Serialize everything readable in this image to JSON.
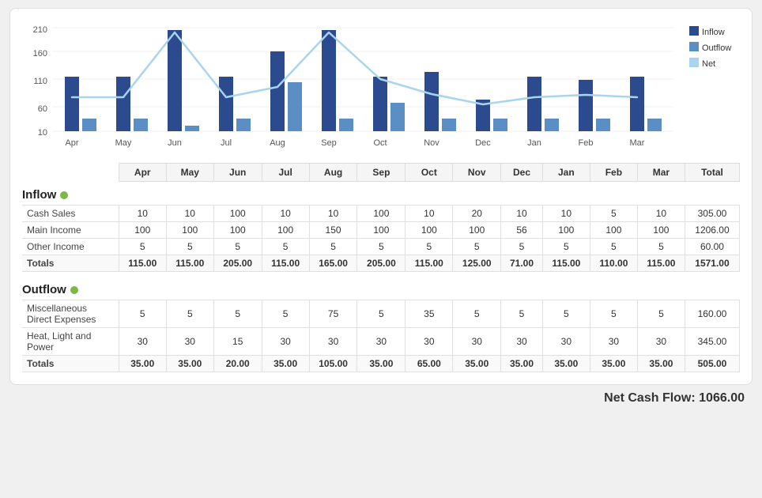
{
  "chart": {
    "months": [
      "Apr",
      "May",
      "Jun",
      "Jul",
      "Aug",
      "Sep",
      "Oct",
      "Nov",
      "Dec",
      "Jan",
      "Feb",
      "Mar"
    ],
    "inflow": [
      115,
      115,
      205,
      115,
      165,
      205,
      115,
      125,
      71,
      115,
      110,
      115
    ],
    "outflow": [
      35,
      35,
      20,
      35,
      105,
      35,
      65,
      35,
      35,
      35,
      35,
      35
    ],
    "yAxis": [
      210,
      160,
      110,
      60,
      10
    ],
    "colors": {
      "inflow": "#2c4b8e",
      "outflow": "#5b8ec4",
      "net": "#a8d4f0"
    }
  },
  "legend": {
    "items": [
      {
        "label": "Inflow",
        "color": "#2c4b8e"
      },
      {
        "label": "Outflow",
        "color": "#5b8ec4"
      },
      {
        "label": "Net",
        "color": "#a8d4f0"
      }
    ]
  },
  "table": {
    "columns": [
      "",
      "Apr",
      "May",
      "Jun",
      "Jul",
      "Aug",
      "Sep",
      "Oct",
      "Nov",
      "Dec",
      "Jan",
      "Feb",
      "Mar",
      "Total"
    ],
    "inflow_section": {
      "label": "Inflow",
      "rows": [
        {
          "name": "Cash Sales",
          "values": [
            10,
            10,
            100,
            10,
            10,
            100,
            10,
            20,
            10,
            10,
            5,
            10
          ],
          "total": "305.00"
        },
        {
          "name": "Main Income",
          "values": [
            100,
            100,
            100,
            100,
            150,
            100,
            100,
            100,
            56,
            100,
            100,
            100
          ],
          "total": "1206.00"
        },
        {
          "name": "Other Income",
          "values": [
            5,
            5,
            5,
            5,
            5,
            5,
            5,
            5,
            5,
            5,
            5,
            5
          ],
          "total": "60.00"
        }
      ],
      "totals": [
        "115.00",
        "115.00",
        "205.00",
        "115.00",
        "165.00",
        "205.00",
        "115.00",
        "125.00",
        "71.00",
        "115.00",
        "110.00",
        "115.00",
        "1571.00"
      ]
    },
    "outflow_section": {
      "label": "Outflow",
      "rows": [
        {
          "name": "Miscellaneous Direct Expenses",
          "values": [
            5,
            5,
            5,
            5,
            75,
            5,
            35,
            5,
            5,
            5,
            5,
            5
          ],
          "total": "160.00"
        },
        {
          "name": "Heat, Light and Power",
          "values": [
            30,
            30,
            15,
            30,
            30,
            30,
            30,
            30,
            30,
            30,
            30,
            30
          ],
          "total": "345.00"
        }
      ],
      "totals": [
        "35.00",
        "35.00",
        "20.00",
        "35.00",
        "105.00",
        "35.00",
        "65.00",
        "35.00",
        "35.00",
        "35.00",
        "35.00",
        "35.00",
        "505.00"
      ]
    }
  },
  "net_cash_flow": {
    "label": "Net Cash Flow:",
    "value": "1066.00"
  }
}
